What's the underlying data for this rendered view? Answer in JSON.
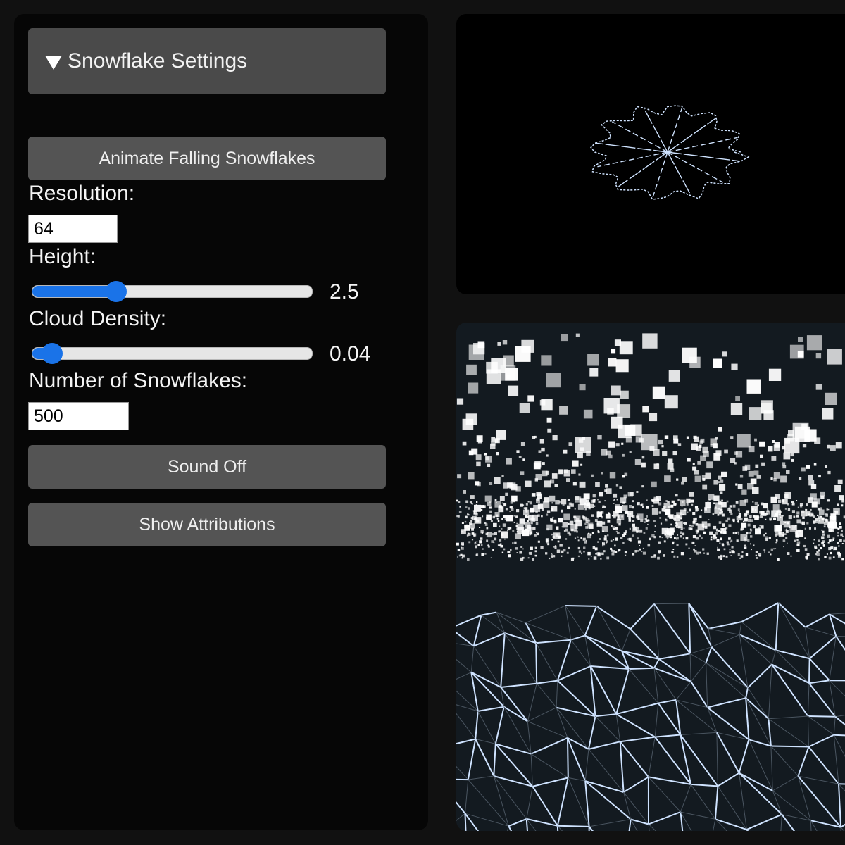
{
  "settings": {
    "title": "Snowflake Settings",
    "animate_label": "Animate Falling Snowflakes",
    "resolution_label": "Resolution:",
    "resolution_value": "64",
    "height_label": "Height:",
    "height_value": "2.5",
    "height_level": 0.3,
    "cloud_density_label": "Cloud Density:",
    "cloud_density_value": "0.04",
    "cloud_density_level": 0.07,
    "snowflakes_label": "Number of Snowflakes:",
    "snowflakes_value": "500",
    "sound_label": "Sound Off",
    "attributions_label": "Show Attributions"
  },
  "colors": {
    "accent": "#1a73e8",
    "panel": "#060606",
    "button": "#545454",
    "header": "#4a4a4a",
    "snow": "#cfe3ff"
  },
  "icons": {
    "header_toggle": "triangle-down-icon"
  }
}
